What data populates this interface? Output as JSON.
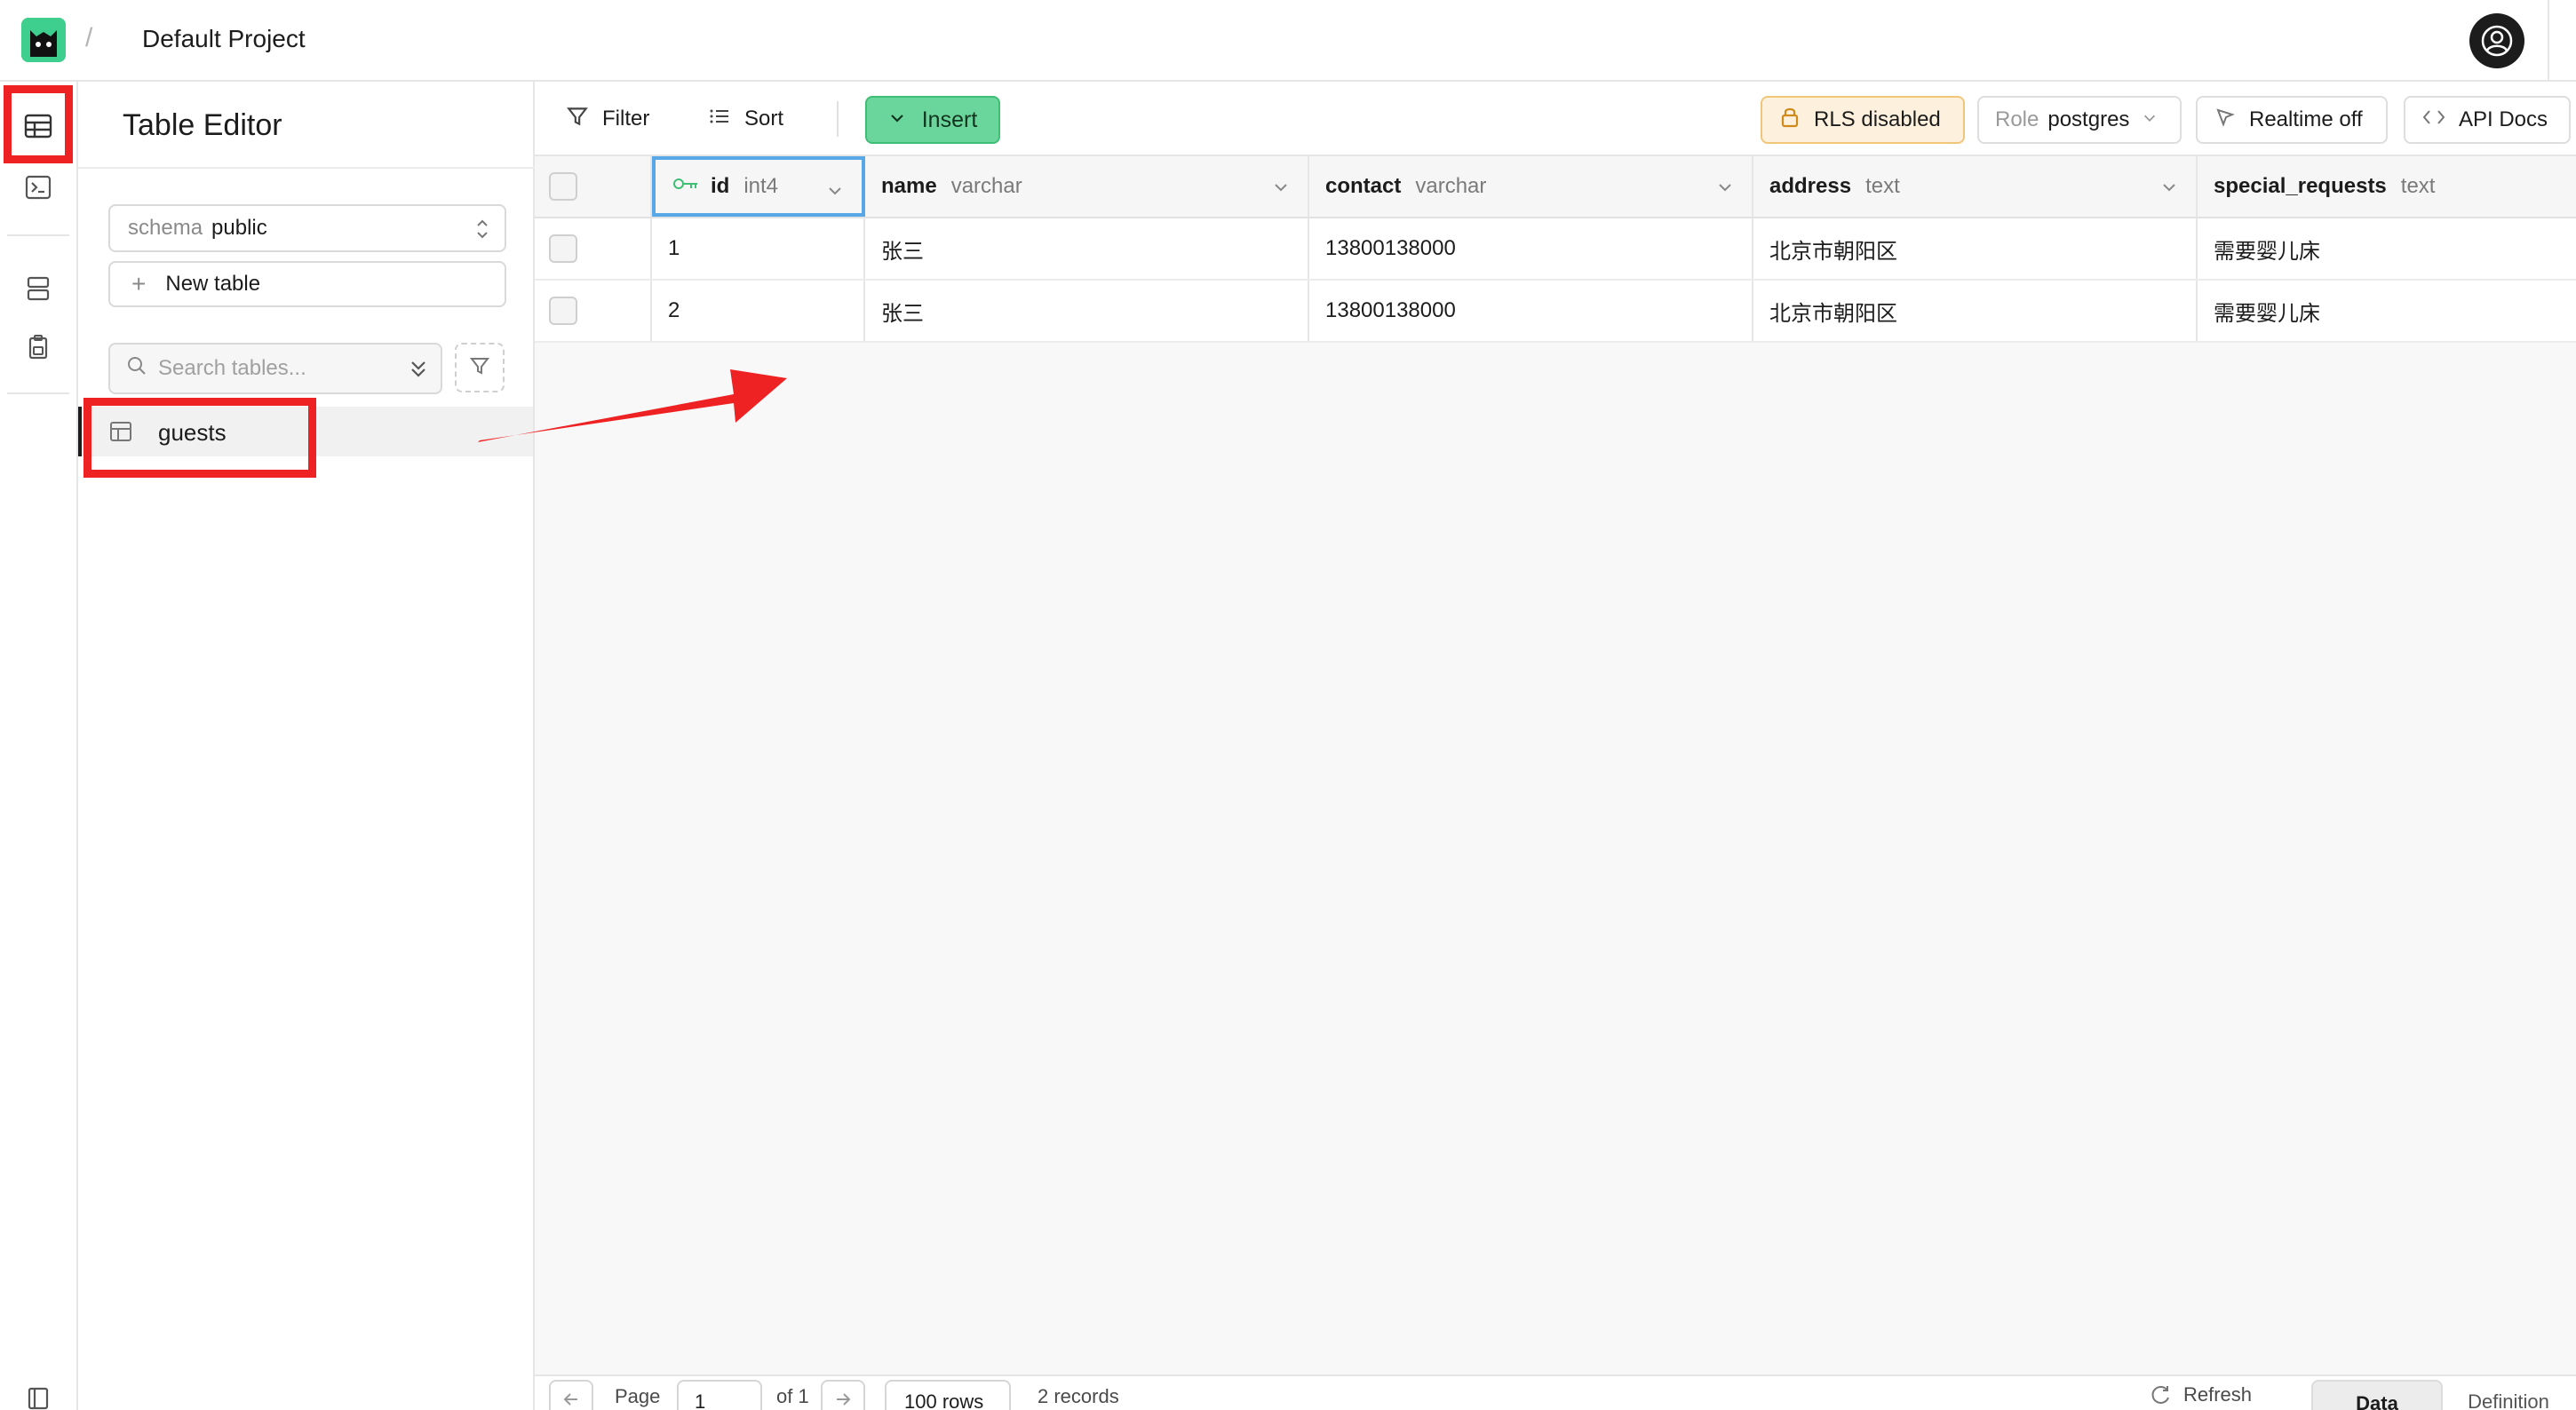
{
  "topbar": {
    "separator": "/",
    "project_name": "Default Project"
  },
  "sidebar": {
    "title": "Table Editor",
    "schema_label": "schema",
    "schema_value": "public",
    "new_table_label": "New table",
    "search_placeholder": "Search tables...",
    "tables": [
      {
        "name": "guests"
      }
    ]
  },
  "toolbar": {
    "filter_label": "Filter",
    "sort_label": "Sort",
    "insert_label": "Insert",
    "rls_label": "RLS disabled",
    "role_label": "Role",
    "role_value": "postgres",
    "realtime_label": "Realtime off",
    "api_docs_label": "API Docs"
  },
  "grid": {
    "columns": [
      {
        "name": "id",
        "type": "int4"
      },
      {
        "name": "name",
        "type": "varchar"
      },
      {
        "name": "contact",
        "type": "varchar"
      },
      {
        "name": "address",
        "type": "text"
      },
      {
        "name": "special_requests",
        "type": "text"
      }
    ],
    "rows": [
      {
        "id": "1",
        "name": "张三",
        "contact": "13800138000",
        "address": "北京市朝阳区",
        "special_requests": "需要婴儿床"
      },
      {
        "id": "2",
        "name": "张三",
        "contact": "13800138000",
        "address": "北京市朝阳区",
        "special_requests": "需要婴儿床"
      }
    ]
  },
  "footer": {
    "page_label": "Page",
    "page_value": "1",
    "of_label": "of 1",
    "rows_label": "100 rows",
    "records_label": "2 records",
    "refresh_label": "Refresh",
    "tab_data": "Data",
    "tab_definition": "Definition"
  },
  "colors": {
    "brand": "#3ecf8e",
    "insert_button": "#6bd69b",
    "rls_badge": "#fdf1dd",
    "annotation": "#ee2222",
    "selected_column": "#58a8e8"
  },
  "icons": [
    "logo-icon",
    "user-circle-icon",
    "table-icon",
    "terminal-icon",
    "database-icon",
    "clipboard-lock-icon",
    "layout-icon",
    "chevron-updown-icon",
    "plus-icon",
    "search-icon",
    "double-chevron-icon",
    "filter-icon",
    "sort-list-icon",
    "chevron-down-icon",
    "lock-icon",
    "cursor-icon",
    "code-icon",
    "key-icon",
    "arrow-left-icon",
    "arrow-right-icon",
    "refresh-icon"
  ]
}
